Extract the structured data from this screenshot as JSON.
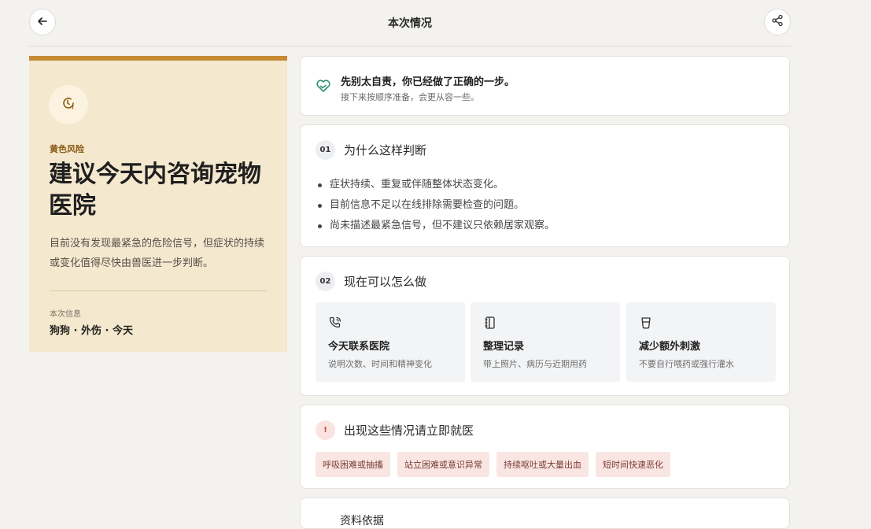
{
  "header": {
    "title": "本次情况",
    "back_icon": "arrow-left-icon",
    "share_icon": "share-icon"
  },
  "risk": {
    "icon": "clock-alert-icon",
    "level_label": "黄色风险",
    "title": "建议今天内咨询宠物医院",
    "description": "目前没有发现最紧急的危险信号，但症状的持续或变化值得尽快由兽医进一步判断。",
    "info_label": "本次信息",
    "info_value": "狗狗 · 外伤 · 今天",
    "accent_color": "#c58a32",
    "background_color": "#f4e8ce"
  },
  "reassure": {
    "icon": "heart-hands-icon",
    "title": "先别太自责，你已经做了正确的一步。",
    "subtitle": "接下来按顺序准备，会更从容一些。"
  },
  "why": {
    "number": "01",
    "title": "为什么这样判断",
    "items": [
      "症状持续、重复或伴随整体状态变化。",
      "目前信息不足以在线排除需要检查的问题。",
      "尚未描述最紧急信号，但不建议只依赖居家观察。"
    ]
  },
  "now": {
    "number": "02",
    "title": "现在可以怎么做",
    "actions": [
      {
        "icon": "phone-icon",
        "title": "今天联系医院",
        "desc": "说明次数、时间和精神变化"
      },
      {
        "icon": "notebook-icon",
        "title": "整理记录",
        "desc": "带上照片、病历与近期用药"
      },
      {
        "icon": "cup-icon",
        "title": "减少额外刺激",
        "desc": "不要自行喂药或强行灌水"
      }
    ]
  },
  "urgent": {
    "number": "!",
    "title": "出现这些情况请立即就医",
    "signs": [
      "呼吸困难或抽搐",
      "站立困难或意识异常",
      "持续呕吐或大量出血",
      "短时间快速恶化"
    ],
    "alert_color": "#c0453a"
  },
  "more": {
    "title": "资料依据"
  }
}
